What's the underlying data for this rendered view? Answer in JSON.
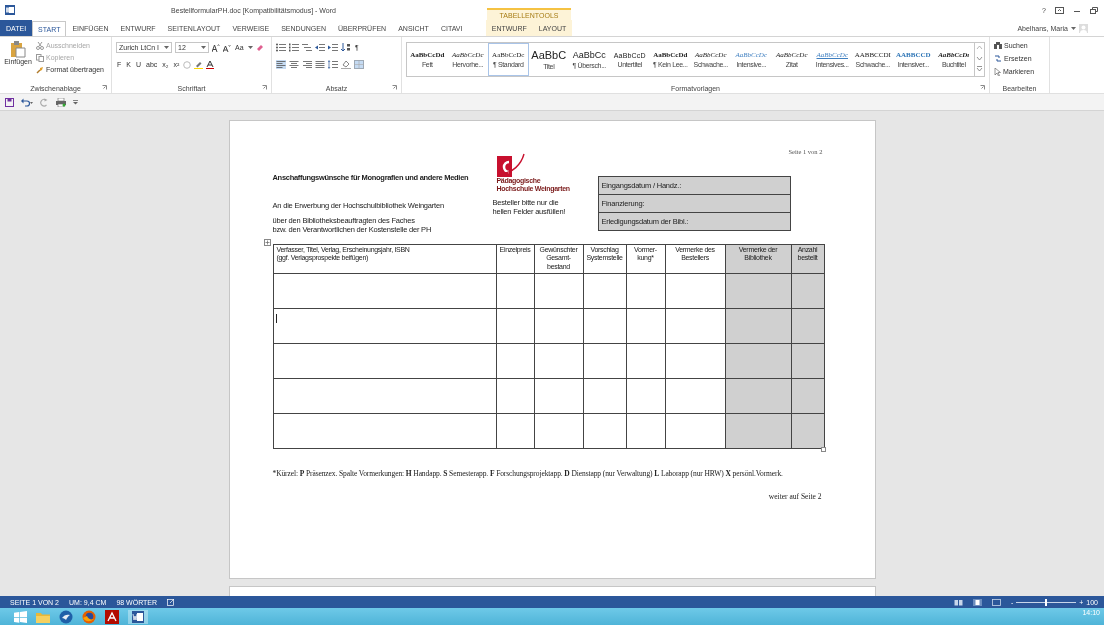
{
  "window": {
    "title": "BestellformularPH.doc [Kompatibilitätsmodus] - Word",
    "context_label": "TABELLENTOOLS",
    "user": "Abelhans, Maria",
    "buttons": [
      "?"
    ]
  },
  "tabs": [
    {
      "label": "DATEI",
      "kind": "file",
      "selected": false
    },
    {
      "label": "START",
      "kind": "normal",
      "selected": true
    },
    {
      "label": "EINFÜGEN",
      "kind": "normal",
      "selected": false
    },
    {
      "label": "ENTWURF",
      "kind": "normal",
      "selected": false
    },
    {
      "label": "SEITENLAYOUT",
      "kind": "normal",
      "selected": false
    },
    {
      "label": "VERWEISE",
      "kind": "normal",
      "selected": false
    },
    {
      "label": "SENDUNGEN",
      "kind": "normal",
      "selected": false
    },
    {
      "label": "ÜBERPRÜFEN",
      "kind": "normal",
      "selected": false
    },
    {
      "label": "ANSICHT",
      "kind": "normal",
      "selected": false
    },
    {
      "label": "CITAVI",
      "kind": "normal",
      "selected": false
    },
    {
      "label": "ENTWURF",
      "kind": "context",
      "selected": false
    },
    {
      "label": "LAYOUT",
      "kind": "context",
      "selected": false
    }
  ],
  "clipboard": {
    "paste": "Einfügen",
    "items": [
      {
        "label": "Ausschneiden",
        "disabled": true
      },
      {
        "label": "Kopieren",
        "disabled": true
      },
      {
        "label": "Format übertragen",
        "disabled": false
      }
    ],
    "label": "Zwischenablage"
  },
  "font": {
    "name": "Zurich LtCn I",
    "size": "12",
    "case_button": "Aa",
    "buttons": [
      "F",
      "K",
      "U",
      "abc",
      "x₂",
      "x²"
    ],
    "label": "Schriftart"
  },
  "paragraph": {
    "pilcrow": "¶",
    "label": "Absatz"
  },
  "styles": {
    "label": "Formatvorlagen",
    "items": [
      {
        "preview": "AaBbCcDd",
        "name": "Fett",
        "kind": "bold",
        "selected": false
      },
      {
        "preview": "AaBbCcDc",
        "name": "Hervorhe...",
        "kind": "italic",
        "selected": false
      },
      {
        "preview": "AaBbCcDc",
        "name": "¶ Standard",
        "kind": "serif",
        "selected": true
      },
      {
        "preview": "AaBbC",
        "name": "Titel",
        "kind": "large",
        "selected": false
      },
      {
        "preview": "AaBbCc",
        "name": "¶ Übersch...",
        "kind": "medium",
        "selected": false
      },
      {
        "preview": "AaBbCcD",
        "name": "Untertitel",
        "kind": "sans",
        "selected": false
      },
      {
        "preview": "AaBbCcDd",
        "name": "¶ Kein Lee...",
        "kind": "bold",
        "selected": false
      },
      {
        "preview": "AaBbCcDc",
        "name": "Schwache...",
        "kind": "italic",
        "selected": false
      },
      {
        "preview": "AaBbCcDc",
        "name": "Intensive...",
        "kind": "accent",
        "selected": false
      },
      {
        "preview": "AaBbCcDc",
        "name": "Zitat",
        "kind": "italic",
        "selected": false
      },
      {
        "preview": "AaBbCcDc",
        "name": "Intensives...",
        "kind": "underlined",
        "selected": false
      },
      {
        "preview": "AABBCCDI",
        "name": "Schwache...",
        "kind": "caps",
        "selected": false
      },
      {
        "preview": "AABBCCD",
        "name": "Intensiver...",
        "kind": "strongcaps",
        "selected": false
      },
      {
        "preview": "AaBbCcDı",
        "name": "Buchtitel",
        "kind": "bolditalic",
        "selected": false
      }
    ]
  },
  "editing": {
    "label": "Bearbeiten",
    "items": [
      {
        "label": "Suchen",
        "kind": "find"
      },
      {
        "label": "Ersetzen",
        "kind": "replace"
      },
      {
        "label": "Markieren",
        "kind": "select"
      }
    ]
  },
  "document": {
    "page_header": "Seite 1 von 2",
    "heading": "Anschaffungswünsche für Monografien und andere Medien",
    "logo_lines": [
      "Pädagogische",
      "Hochschule Weingarten"
    ],
    "intro": [
      "An die Erwerbung der Hochschulbibliothek Weingarten",
      "über den Bibliotheksbeauftragten des Faches",
      "bzw. den Verantwortlichen der Kostenstelle der PH"
    ],
    "note": "Besteller bitte nur die\nhellen Felder ausfüllen!",
    "admin_fields": [
      {
        "label": "Eingangsdatum / Handz.:",
        "shaded": true
      },
      {
        "label": "Finanzierung:",
        "shaded": true
      },
      {
        "label": "Erledigungsdatum der Bibl.:",
        "shaded": true
      }
    ],
    "table": {
      "columns": [
        {
          "label": "Verfasser, Titel, Verlag, Erscheinungsjahr, ISBN\n(ggf. Verlagsprospekte beifügen)",
          "shaded": false
        },
        {
          "label": "Einzelpreis",
          "shaded": false
        },
        {
          "label": "Gewünschter\nGesamt-\nbestand",
          "shaded": false
        },
        {
          "label": "Vorschlag\nSystemstelle",
          "shaded": false
        },
        {
          "label": "Vormer-\nkung*",
          "shaded": false
        },
        {
          "label": "Vermerke des\nBestellers",
          "shaded": false
        },
        {
          "label": "Vermerke der\nBibliothek",
          "shaded": true
        },
        {
          "label": "Anzahl\nbestellt",
          "shaded": true
        }
      ],
      "rows": [
        {
          "kind": "empty",
          "cursor": false
        },
        {
          "kind": "empty",
          "cursor": true
        },
        {
          "kind": "empty",
          "cursor": false
        },
        {
          "kind": "empty",
          "cursor": false
        },
        {
          "kind": "empty",
          "cursor": false
        }
      ]
    },
    "footnote": "*Kürzel: **P** Präsenzex.  Spalte Vormerkungen: **H** Handapp. **S** Semesterapp. **F** Forschungsprojektapp. **D** Dienstapp (nur Verwaltung) **L** Laborapp (nur HRW) **X** persönl.Vormerk.",
    "continued": "weiter auf Seite 2"
  },
  "status_bar": {
    "items": [
      "SEITE 1 VON 2",
      "UM: 9,4 CM",
      "98 WÖRTER"
    ],
    "zoom": {
      "minus": "-",
      "plus": "+",
      "level": 0.5,
      "reading": "100"
    }
  },
  "taskbar": {
    "clock": "14:10"
  }
}
